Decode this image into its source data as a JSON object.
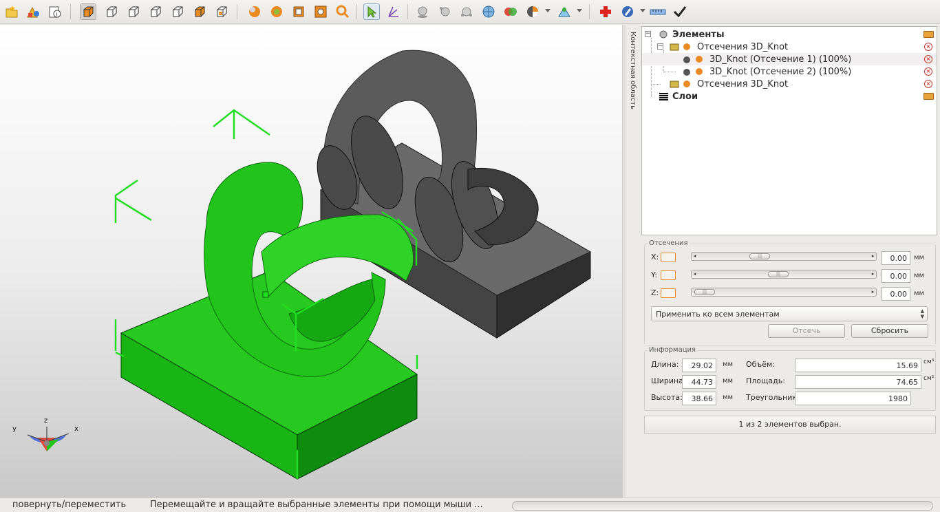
{
  "toolbar": {
    "items": [
      "open-file",
      "add-object",
      "object-info",
      "view-iso",
      "view-front",
      "view-right",
      "view-top",
      "view-left",
      "view-back",
      "view-bottom",
      "shaded",
      "smooth",
      "wireframe",
      "box-view",
      "zoom",
      "select",
      "rotate-move",
      "light-1",
      "light-2",
      "light-3",
      "globe",
      "spheres",
      "shaders",
      "perspective",
      "add",
      "edit",
      "ruler",
      "apply"
    ]
  },
  "tree": {
    "root_label": "Элементы",
    "group1_label": "Отсечения 3D_Knot",
    "item1_label": "3D_Knot (Отсечение 1) (100%)",
    "item2_label": "3D_Knot (Отсечение 2) (100%)",
    "group2_label": "Отсечения 3D_Knot",
    "layers_label": "Слои"
  },
  "vertical_tab": "Контекстная область",
  "cuts": {
    "title": "Отсечения",
    "x_label": "X:",
    "y_label": "Y:",
    "z_label": "Z:",
    "x_value": "0.00",
    "y_value": "0.00",
    "z_value": "0.00",
    "unit": "мм",
    "apply_option": "Применить ко всем элементам",
    "cut_button": "Отсечь",
    "reset_button": "Сбросить"
  },
  "info": {
    "title": "Информация",
    "length_label": "Длина:",
    "length_value": "29.02",
    "width_label": "Ширина:",
    "width_value": "44.73",
    "height_label": "Высота:",
    "height_value": "38.66",
    "mm": "мм",
    "volume_label": "Объём:",
    "volume_value": "15.69",
    "volume_unit": "см³",
    "area_label": "Площадь:",
    "area_value": "74.65",
    "area_unit": "см²",
    "triangles_label": "Треугольники",
    "triangles_value": "1980"
  },
  "selection_status": "1 из 2 элементов выбран.",
  "axes": {
    "x": "x",
    "y": "y",
    "z": "z"
  },
  "status": {
    "mode": "повернуть/переместить",
    "hint": "Перемещайте и вращайте выбранные элементы при помощи мыши ..."
  },
  "colors": {
    "selected_object": "#22c41c",
    "other_object": "#545454",
    "accent": "#e08a2a"
  }
}
